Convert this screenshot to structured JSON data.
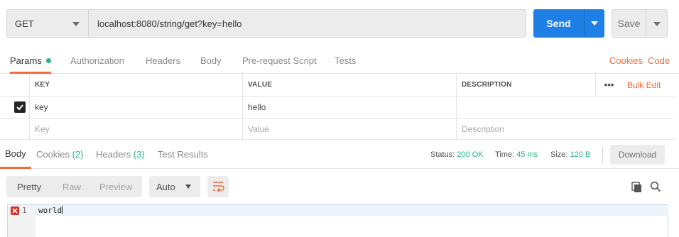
{
  "request": {
    "method": "GET",
    "url": "localhost:8080/string/get?key=hello",
    "send_label": "Send",
    "save_label": "Save"
  },
  "request_tabs": [
    {
      "label": "Params",
      "active": true,
      "indicator": "green-dot"
    },
    {
      "label": "Authorization"
    },
    {
      "label": "Headers"
    },
    {
      "label": "Body"
    },
    {
      "label": "Pre-request Script"
    },
    {
      "label": "Tests"
    }
  ],
  "request_links": {
    "cookies": "Cookies",
    "code": "Code"
  },
  "params": {
    "headers": {
      "key": "KEY",
      "value": "VALUE",
      "description": "DESCRIPTION"
    },
    "more_label": "•••",
    "bulk_edit": "Bulk Edit",
    "rows": [
      {
        "checked": true,
        "key": "key",
        "value": "hello",
        "description": ""
      }
    ],
    "placeholder": {
      "key": "Key",
      "value": "Value",
      "description": "Description"
    }
  },
  "response_tabs": {
    "body": "Body",
    "cookies": "Cookies",
    "cookies_count": "(2)",
    "headers": "Headers",
    "headers_count": "(3)",
    "test_results": "Test Results"
  },
  "response_meta": {
    "status_label": "Status:",
    "status_value": "200 OK",
    "time_label": "Time:",
    "time_value": "45 ms",
    "size_label": "Size:",
    "size_value": "120 B",
    "download_label": "Download"
  },
  "response_toolbar": {
    "formats": [
      "Pretty",
      "Raw",
      "Preview"
    ],
    "active_format": "Pretty",
    "mode": "Auto"
  },
  "editor": {
    "line_number": "1",
    "content": "world"
  },
  "colors": {
    "accent_orange": "#f26b3a",
    "send_blue": "#1f7fe5",
    "status_green": "#26b47f",
    "error_red": "#d93025"
  }
}
